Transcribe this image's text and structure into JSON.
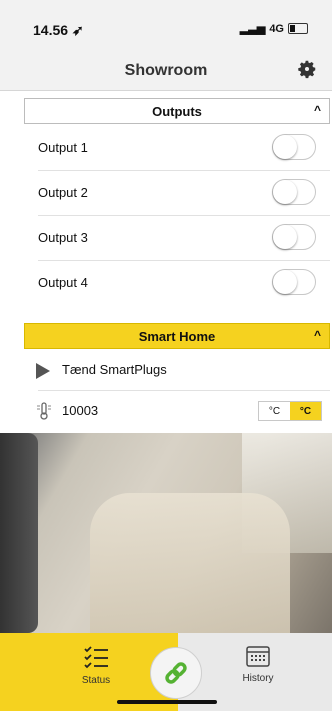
{
  "status_bar": {
    "time": "14.56",
    "network": "4G"
  },
  "header": {
    "title": "Showroom"
  },
  "outputs": {
    "title": "Outputs",
    "items": [
      {
        "label": "Output 1",
        "on": false
      },
      {
        "label": "Output 2",
        "on": false
      },
      {
        "label": "Output 3",
        "on": false
      },
      {
        "label": "Output 4",
        "on": false
      }
    ]
  },
  "smart_home": {
    "title": "Smart Home",
    "plug_label": "Tænd SmartPlugs",
    "sensor_value": "10003",
    "units": {
      "c1": "°C",
      "c2": "°C"
    }
  },
  "tabs": {
    "status": "Status",
    "history": "History"
  },
  "colors": {
    "accent": "#f5d21f",
    "link_green": "#55b233"
  }
}
